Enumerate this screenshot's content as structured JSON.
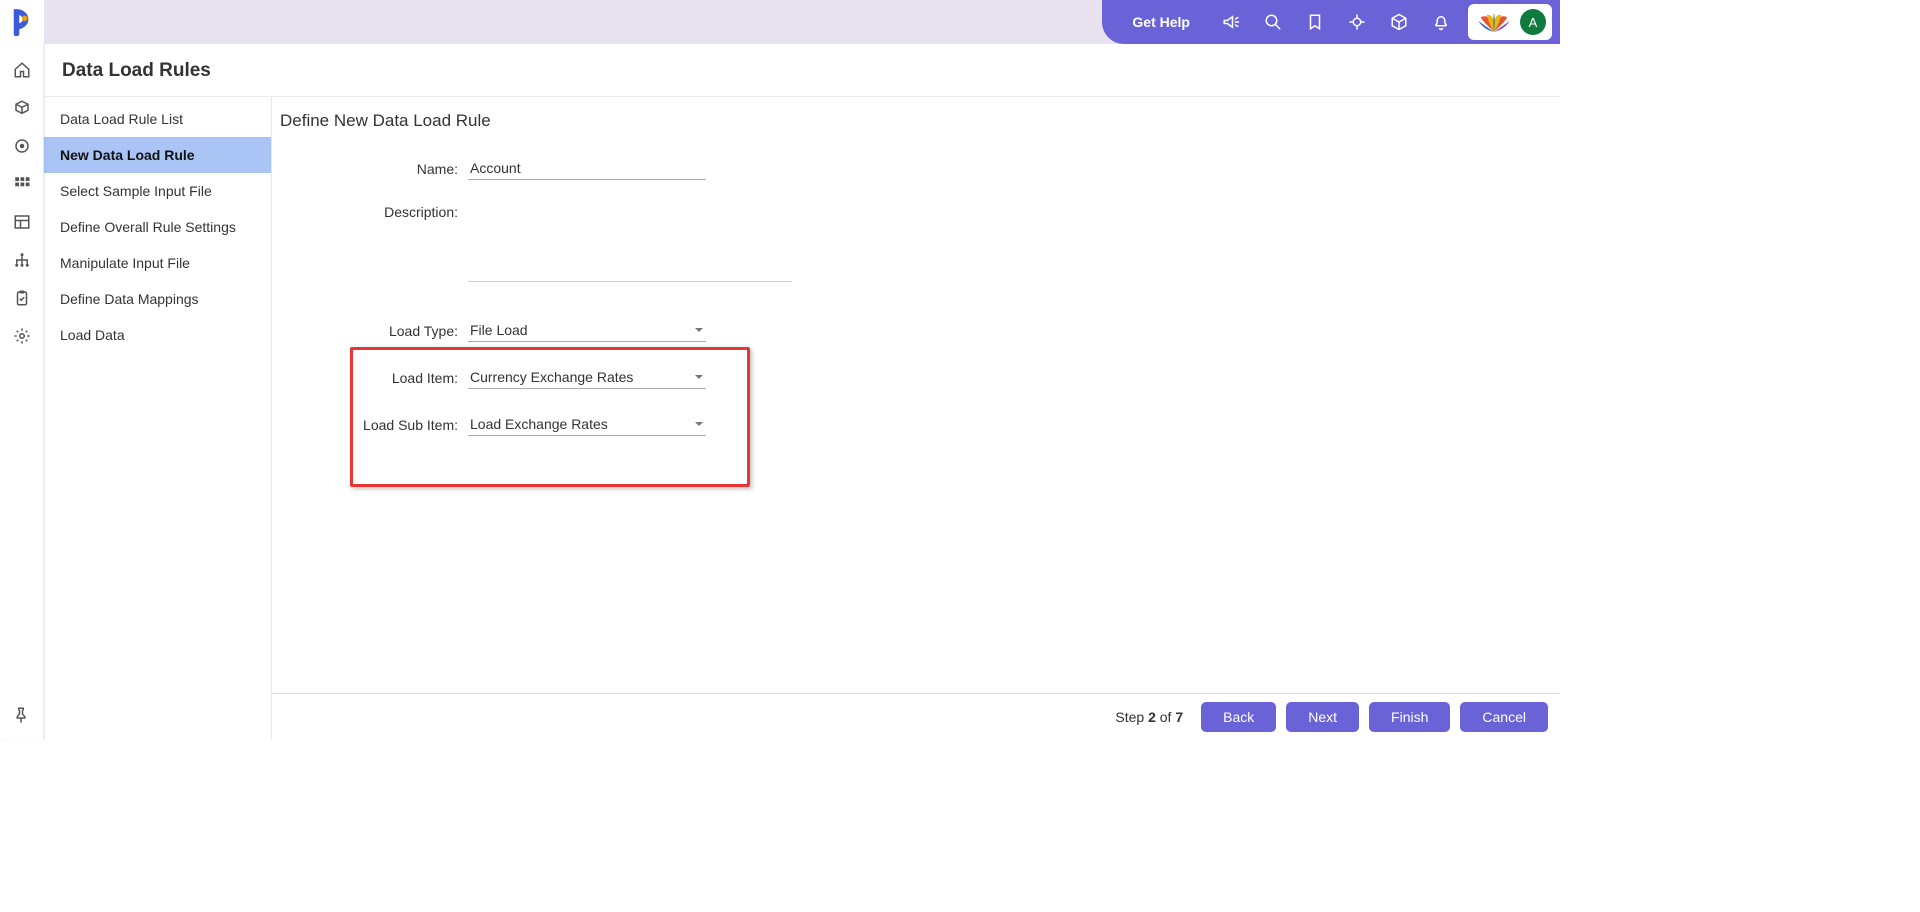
{
  "header": {
    "get_help": "Get Help",
    "avatar_initial": "A"
  },
  "page": {
    "title": "Data Load Rules",
    "panel_title": "Define New Data Load Rule"
  },
  "steps": [
    "Data Load Rule List",
    "New Data Load Rule",
    "Select Sample Input File",
    "Define Overall Rule Settings",
    "Manipulate Input File",
    "Define Data Mappings",
    "Load Data"
  ],
  "steps_active_index": 1,
  "form": {
    "name_label": "Name:",
    "name_value": "Account",
    "description_label": "Description:",
    "description_value": "",
    "load_type_label": "Load Type:",
    "load_type_value": "File Load",
    "load_item_label": "Load Item:",
    "load_item_value": "Currency Exchange Rates",
    "load_sub_item_label": "Load Sub Item:",
    "load_sub_item_value": "Load Exchange Rates"
  },
  "footer": {
    "step_word": "Step",
    "step_current": "2",
    "step_of": "of",
    "step_total": "7",
    "back": "Back",
    "next": "Next",
    "finish": "Finish",
    "cancel": "Cancel"
  }
}
